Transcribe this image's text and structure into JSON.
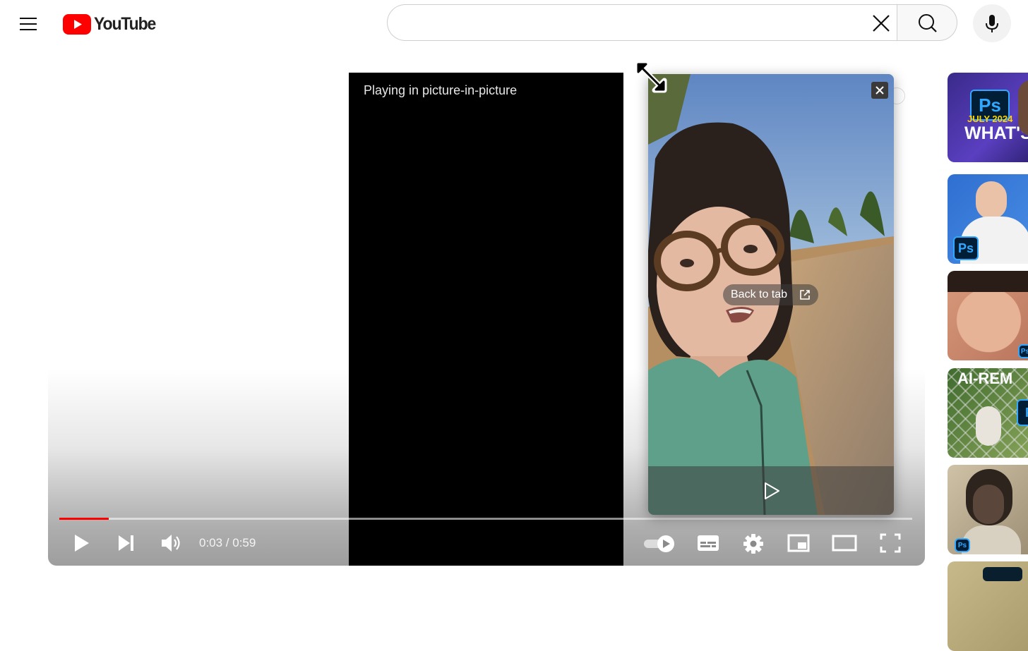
{
  "header": {
    "logo_text": "YouTube",
    "country_code": "",
    "search": {
      "value": "",
      "placeholder": ""
    }
  },
  "player": {
    "pip_message": "Playing in picture-in-picture",
    "current_time": "0:03",
    "duration": "0:59",
    "time_display": "0:03 / 0:59",
    "progress_fraction": 0.058,
    "autoplay": "on"
  },
  "pip_window": {
    "back_to_tab_label": "Back to tab"
  },
  "recommendations": [
    {
      "id": "rec-1",
      "caption_top": "JULY 2024",
      "caption_main": "WHAT'S",
      "badge": "Ps"
    },
    {
      "id": "rec-2",
      "badge": "Ps"
    },
    {
      "id": "rec-3",
      "badge": "Ps"
    },
    {
      "id": "rec-4",
      "caption_main": "AI-REM",
      "badge": "P"
    },
    {
      "id": "rec-5",
      "badge": "Ps"
    },
    {
      "id": "rec-6"
    }
  ],
  "colors": {
    "brand_red": "#ff0000",
    "progress_red": "#ff0000",
    "ps_blue": "#31a8ff",
    "ps_dark": "#001e36"
  }
}
